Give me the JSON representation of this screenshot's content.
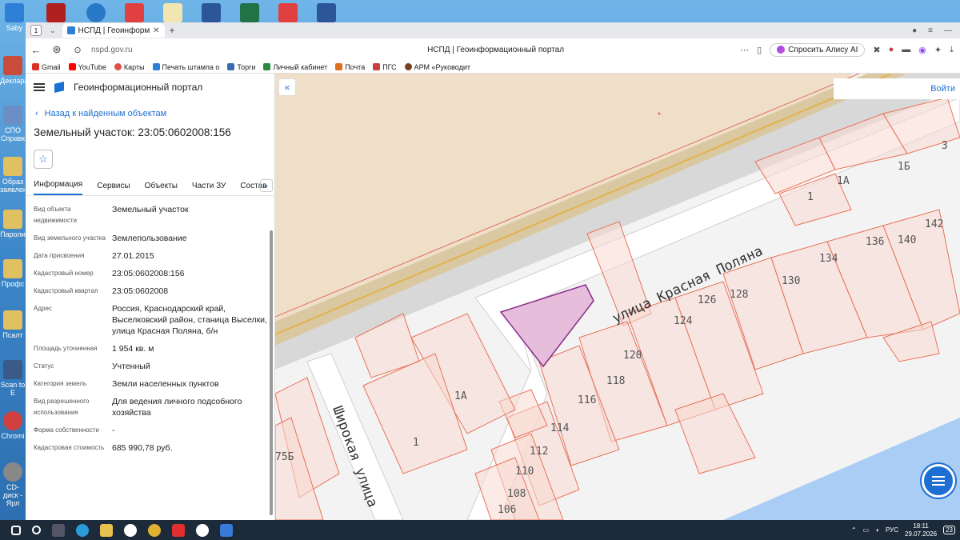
{
  "desktop": {
    "icons": [
      {
        "label": "Saby",
        "color": "#2e7fd8"
      },
      {
        "label": "Деклара",
        "color": "#c84b3c"
      },
      {
        "label": "СПО Справк",
        "color": "#6b8ec4"
      },
      {
        "label": "Образ заявлен",
        "color": "#e0c060"
      },
      {
        "label": "Пароли",
        "color": "#e0c060"
      },
      {
        "label": "Профс",
        "color": "#e0c060"
      },
      {
        "label": "Псалт",
        "color": "#e0c060"
      },
      {
        "label": "Scan to E",
        "color": "#3a5a8a"
      },
      {
        "label": "Chromi",
        "color": "#d04040"
      },
      {
        "label": "CD-диск - Ярл",
        "color": "#888888"
      }
    ]
  },
  "browser": {
    "tab_count": "1",
    "tab_title": "НСПД | Геоинформационны",
    "url": "nspd.gov.ru",
    "page_title": "НСПД | Геоинформационный портал",
    "alice_label": "Спросить Алису AI",
    "bookmarks": [
      {
        "label": "Gmail",
        "color": "#d93025"
      },
      {
        "label": "YouTube",
        "color": "#ff0000"
      },
      {
        "label": "Карты",
        "color": "#e05040"
      },
      {
        "label": "Печать штампа о",
        "color": "#2e7fd8"
      },
      {
        "label": "Торги",
        "color": "#3a6ab0"
      },
      {
        "label": "Личный кабинет",
        "color": "#2a8a40"
      },
      {
        "label": "Почта",
        "color": "#e07020"
      },
      {
        "label": "ПГС",
        "color": "#c84040"
      },
      {
        "label": "АРМ «Руководит",
        "color": "#7a4020"
      }
    ]
  },
  "panel": {
    "portal_name": "Геоинформационный портал",
    "back_link": "Назад к найденным объектам",
    "object_title": "Земельный участок: 23:05:0602008:156",
    "tabs": [
      {
        "label": "Информация",
        "active": true
      },
      {
        "label": "Сервисы",
        "active": false
      },
      {
        "label": "Объекты",
        "active": false
      },
      {
        "label": "Части ЗУ",
        "active": false
      },
      {
        "label": "Состав",
        "active": false
      }
    ],
    "properties": [
      {
        "key": "Вид объекта недвижимости",
        "value": "Земельный участок"
      },
      {
        "key": "Вид земельного участка",
        "value": "Землепользование"
      },
      {
        "key": "Дата присвоения",
        "value": "27.01.2015"
      },
      {
        "key": "Кадастровый номер",
        "value": "23:05:0602008:156"
      },
      {
        "key": "Кадастровый квартал",
        "value": "23:05:0602008"
      },
      {
        "key": "Адрес",
        "value": "Россия, Краснодарский край, Выселковский район, станица Выселки, улица Красная Поляна, б/н"
      },
      {
        "key": "Площадь уточненная",
        "value": "1 954 кв. м"
      },
      {
        "key": "Статус",
        "value": "Учтенный"
      },
      {
        "key": "Категория земель",
        "value": "Земли населенных пунктов"
      },
      {
        "key": "Вид разрешенного использования",
        "value": "Для ведения личного подсобного хозяйства"
      },
      {
        "key": "Форма собственности",
        "value": "-"
      },
      {
        "key": "Кадастровая стоимость",
        "value": "685 990,78 руб."
      }
    ]
  },
  "map": {
    "login_label": "Войти",
    "street_main": "улица Красная Поляна",
    "street_side": "Широкая улица",
    "house_labels": [
      "3",
      "1А",
      "1Б",
      "1",
      "142",
      "136",
      "140",
      "134",
      "130",
      "126",
      "128",
      "124",
      "120",
      "118",
      "116",
      "114",
      "112",
      "110",
      "108",
      "106",
      "1А",
      "1",
      "75Б"
    ],
    "colors": {
      "parcel_stroke": "#e8735a",
      "parcel_fill": "#f7d8cf",
      "selected_fill": "#e6bedc",
      "selected_stroke": "#8a2a8a",
      "road": "#d9c8a2",
      "water": "#a9cdf5"
    }
  },
  "taskbar": {
    "lang": "РУС",
    "time": "18:11",
    "date": "29.07.2026",
    "notif": "23"
  }
}
